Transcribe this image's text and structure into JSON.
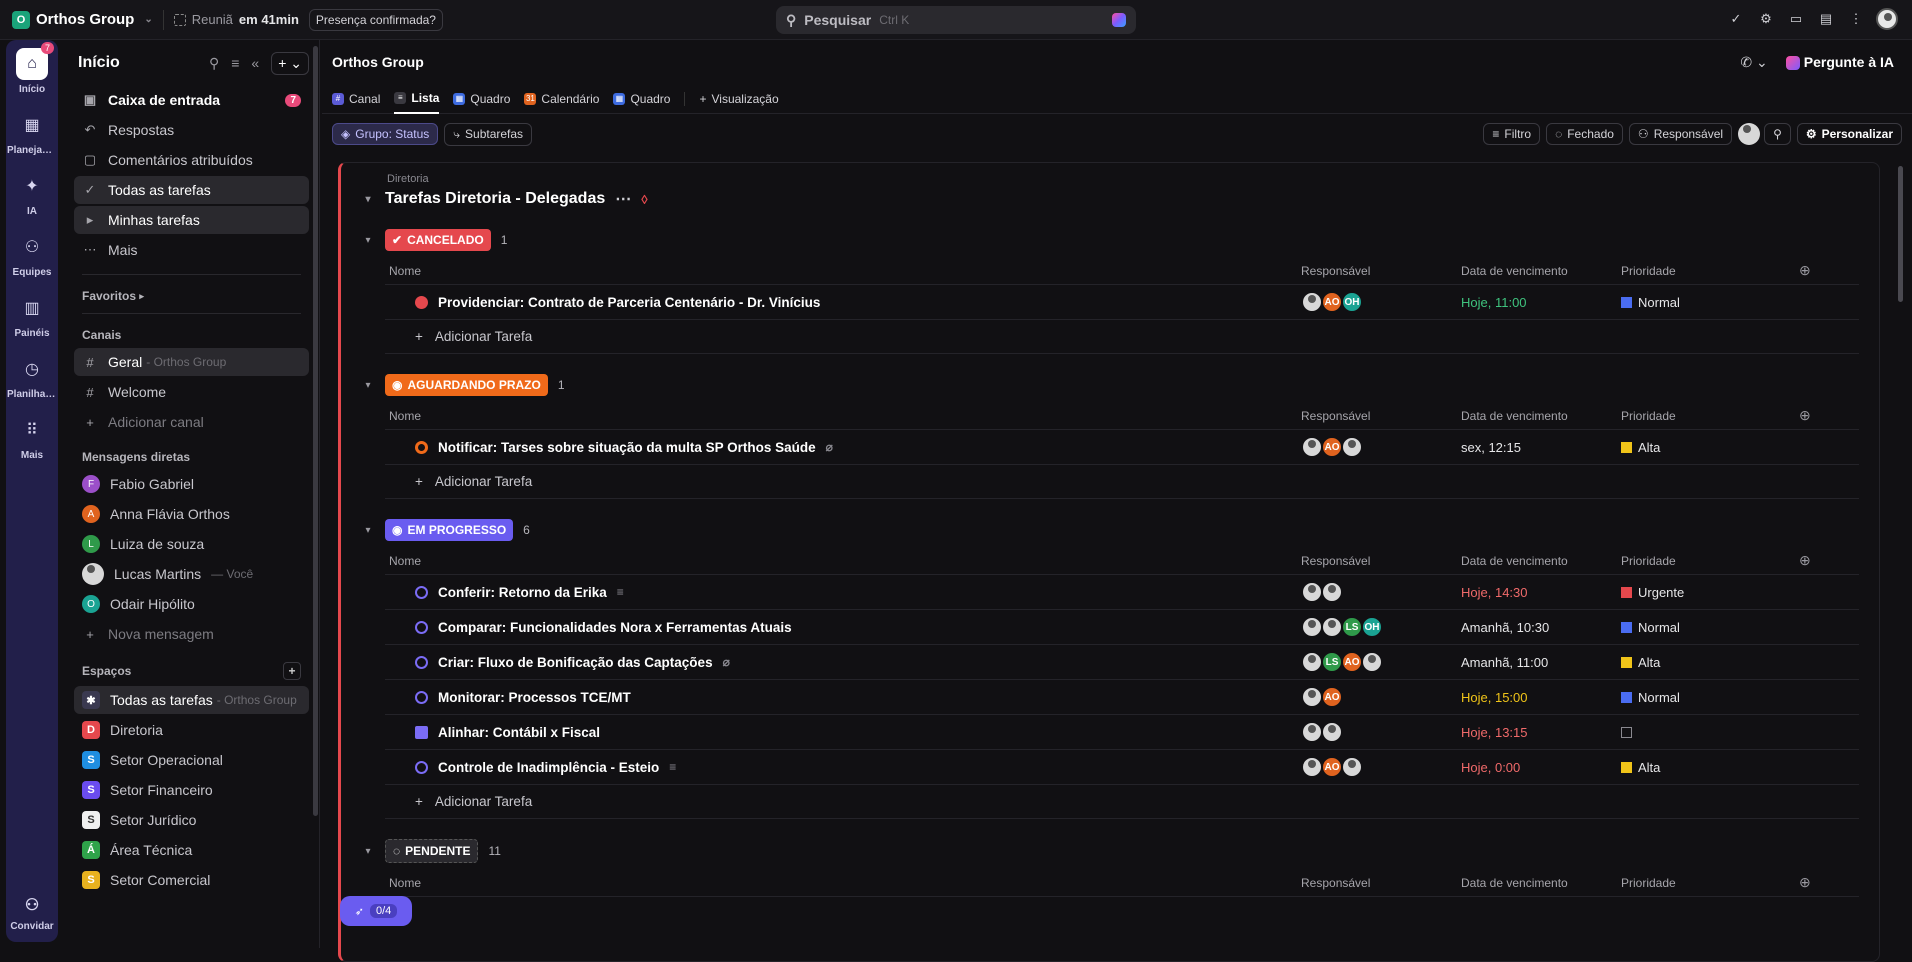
{
  "topbar": {
    "workspace_letter": "O",
    "workspace_name": "Orthos Group",
    "meeting_label": "Reuniã",
    "meeting_time": "em 41min",
    "meeting_status": "Presença confirmada?",
    "search_placeholder": "Pesquisar",
    "search_shortcut": "Ctrl K"
  },
  "rail": {
    "items": [
      {
        "label": "Início",
        "icon": "home-icon",
        "badge": "7"
      },
      {
        "label": "Planejador",
        "icon": "calendar-icon",
        "badge": ""
      },
      {
        "label": "IA",
        "icon": "ai-icon",
        "badge": ""
      },
      {
        "label": "Equipes",
        "icon": "team-icon",
        "badge": ""
      },
      {
        "label": "Painéis",
        "icon": "dashboard-icon",
        "badge": ""
      },
      {
        "label": "Planilhas ...",
        "icon": "clock-icon",
        "badge": ""
      },
      {
        "label": "Mais",
        "icon": "grid-icon",
        "badge": ""
      }
    ],
    "bottom_label": "Convidar"
  },
  "sidebar": {
    "title": "Início",
    "nav": [
      {
        "label": "Caixa de entrada",
        "badge": "7"
      },
      {
        "label": "Respostas"
      },
      {
        "label": "Comentários atribuídos"
      },
      {
        "label": "Todas as tarefas"
      },
      {
        "label": "Minhas tarefas"
      },
      {
        "label": "Mais"
      }
    ],
    "favorites_title": "Favoritos",
    "channels_title": "Canais",
    "channels": [
      {
        "label": "Geral",
        "suffix": "- Orthos Group"
      },
      {
        "label": "Welcome",
        "suffix": ""
      }
    ],
    "add_channel": "Adicionar canal",
    "dm_title": "Mensagens diretas",
    "dms": [
      {
        "initial": "F",
        "name": "Fabio Gabriel",
        "suffix": "",
        "color": "#9b4fc9"
      },
      {
        "initial": "A",
        "name": "Anna Flávia Orthos",
        "suffix": "",
        "color": "#e0631f"
      },
      {
        "initial": "L",
        "name": "Luiza de souza",
        "suffix": "",
        "color": "#2f9a4a"
      },
      {
        "initial": "",
        "name": "Lucas Martins",
        "suffix": "— Você",
        "color": "#d8d8d8"
      },
      {
        "initial": "O",
        "name": "Odair Hipólito",
        "suffix": "",
        "color": "#1aa393"
      }
    ],
    "new_message": "Nova mensagem",
    "spaces_title": "Espaços",
    "spaces": [
      {
        "initial": "✱",
        "name": "Todas as tarefas",
        "suffix": "- Orthos Group",
        "color": "#3a3950"
      },
      {
        "initial": "D",
        "name": "Diretoria",
        "suffix": "",
        "color": "#e5484d"
      },
      {
        "initial": "S",
        "name": "Setor Operacional",
        "suffix": "",
        "color": "#1f8ee0"
      },
      {
        "initial": "S",
        "name": "Setor Financeiro",
        "suffix": "",
        "color": "#6a4cf0"
      },
      {
        "initial": "S",
        "name": "Setor Jurídico",
        "suffix": "",
        "color": "#f0f0f0"
      },
      {
        "initial": "Á",
        "name": "Área Técnica",
        "suffix": "",
        "color": "#2fa34a"
      },
      {
        "initial": "S",
        "name": "Setor Comercial",
        "suffix": "",
        "color": "#e8b21f"
      }
    ]
  },
  "main": {
    "title": "Orthos Group",
    "ask_ai": "Pergunte à IA",
    "tabs": [
      {
        "label": "Canal",
        "color": "#5b5bd6",
        "glyph": "#"
      },
      {
        "label": "Lista",
        "color": "#3a3940",
        "glyph": "≡"
      },
      {
        "label": "Quadro",
        "color": "#3d6be0",
        "glyph": "▦"
      },
      {
        "label": "Calendário",
        "color": "#e0631f",
        "glyph": "31"
      },
      {
        "label": "Quadro",
        "color": "#3d6be0",
        "glyph": "▦"
      }
    ],
    "add_view": "Visualização",
    "filters": {
      "group": "Grupo: Status",
      "subtasks": "Subtarefas",
      "filter": "Filtro",
      "closed": "Fechado",
      "assignee": "Responsável",
      "customize": "Personalizar"
    },
    "breadcrumb": "Diretoria",
    "list_title": "Tarefas Diretoria - Delegadas",
    "columns": {
      "name": "Nome",
      "assignee": "Responsável",
      "due": "Data de vencimento",
      "priority": "Prioridade"
    },
    "add_task": "Adicionar Tarefa",
    "groups": [
      {
        "label": "CANCELADO",
        "count": "1",
        "color": "#e5484d",
        "tasks": [
          {
            "name": "Providenciar: Contrato de Parceria Centenário - Dr. Vinícius",
            "status_color": "#e5484d",
            "assignees": [
              "photo",
              "AO",
              "OH"
            ],
            "due": "Hoje, 11:00",
            "due_color": "#3fc37e",
            "priority": "Normal",
            "flag_color": "#4a6cf0",
            "extra": ""
          }
        ]
      },
      {
        "label": "AGUARDANDO PRAZO",
        "count": "1",
        "color": "#f06a1a",
        "tasks": [
          {
            "name": "Notificar: Tarses sobre situação da multa SP Orthos Saúde",
            "status_color": "#f06a1a",
            "assignees": [
              "photo",
              "AO",
              "photo"
            ],
            "due": "sex, 12:15",
            "due_color": "#e6e6e8",
            "priority": "Alta",
            "flag_color": "#f0c419",
            "extra": "attach-icon"
          }
        ]
      },
      {
        "label": "EM PROGRESSO",
        "count": "6",
        "color": "#6a5cf0",
        "tasks": [
          {
            "name": "Conferir: Retorno da Erika",
            "status_color": "#7b6cf5",
            "assignees": [
              "photo",
              "photo"
            ],
            "due": "Hoje, 14:30",
            "due_color": "#f06a6a",
            "priority": "Urgente",
            "flag_color": "#e5484d",
            "extra": "description-icon"
          },
          {
            "name": "Comparar: Funcionalidades Nora x Ferramentas Atuais",
            "status_color": "#7b6cf5",
            "assignees": [
              "photo",
              "photo",
              "LS",
              "OH"
            ],
            "due": "Amanhã, 10:30",
            "due_color": "#e6e6e8",
            "priority": "Normal",
            "flag_color": "#4a6cf0",
            "extra": ""
          },
          {
            "name": "Criar: Fluxo de Bonificação das Captações",
            "status_color": "#7b6cf5",
            "assignees": [
              "photo",
              "LS",
              "AO",
              "photo"
            ],
            "due": "Amanhã, 11:00",
            "due_color": "#e6e6e8",
            "priority": "Alta",
            "flag_color": "#f0c419",
            "extra": "attach-icon"
          },
          {
            "name": "Monitorar: Processos TCE/MT",
            "status_color": "#7b6cf5",
            "assignees": [
              "photo",
              "AO"
            ],
            "due": "Hoje, 15:00",
            "due_color": "#f0c419",
            "priority": "Normal",
            "flag_color": "#4a6cf0",
            "extra": ""
          },
          {
            "name": "Alinhar: Contábil x Fiscal",
            "status_color": "#7b6cf5",
            "assignees": [
              "photo",
              "photo"
            ],
            "due": "Hoje, 13:15",
            "due_color": "#f06a6a",
            "priority": "",
            "flag_color": "#8a8990",
            "extra": ""
          },
          {
            "name": "Controle de Inadimplência - Esteio",
            "status_color": "#7b6cf5",
            "assignees": [
              "photo",
              "AO",
              "photo"
            ],
            "due": "Hoje, 0:00",
            "due_color": "#f06a6a",
            "priority": "Alta",
            "flag_color": "#f0c419",
            "extra": "description-icon"
          }
        ]
      },
      {
        "label": "PENDENTE",
        "count": "11",
        "color": "#2a292e",
        "tasks": []
      }
    ],
    "rocket_progress": "0/4"
  }
}
